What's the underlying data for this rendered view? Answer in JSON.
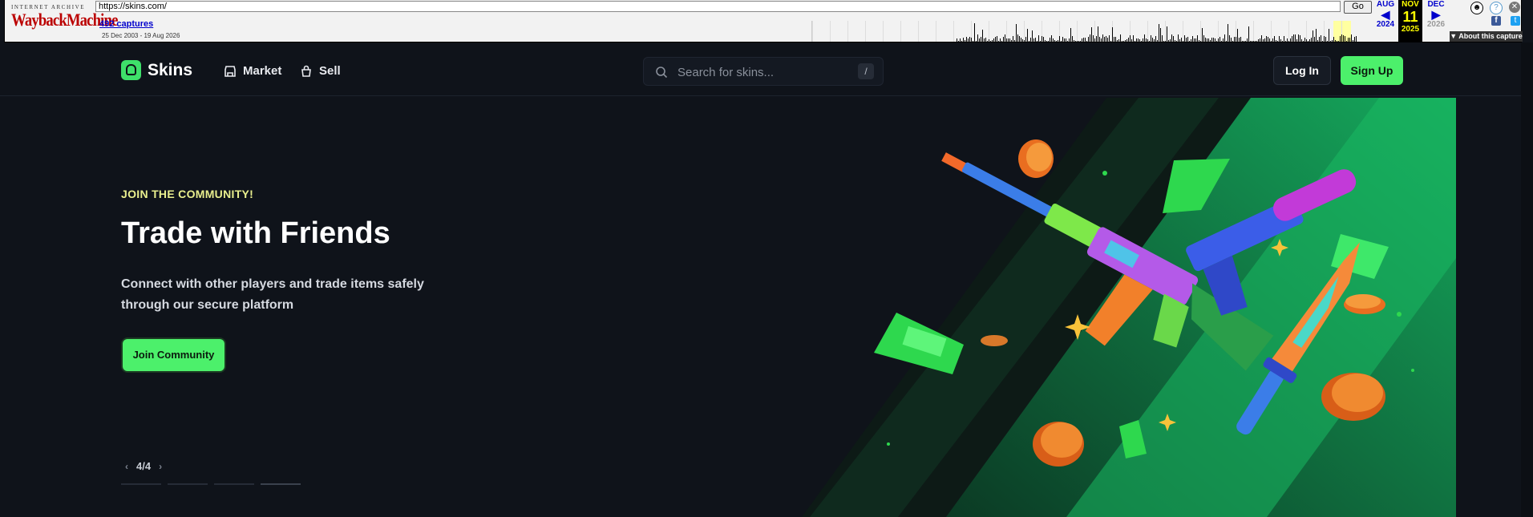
{
  "wayback": {
    "logo_top": "INTERNET ARCHIVE",
    "logo_main": "WaybackMachine",
    "url": "https://skins.com/",
    "go_label": "Go",
    "captures": "492 captures",
    "date_range": "25 Dec 2003 - 19 Aug 2026",
    "prev_month": "AUG",
    "cur_month": "NOV",
    "next_month": "DEC",
    "cur_day": "11",
    "prev_year": "2024",
    "cur_year": "2025",
    "next_year": "2026",
    "about": "About this capture"
  },
  "nav": {
    "brand": "Skins",
    "market": "Market",
    "sell": "Sell",
    "search_placeholder": "Search for skins...",
    "search_shortcut": "/",
    "login": "Log In",
    "signup": "Sign Up"
  },
  "hero": {
    "eyebrow": "JOIN THE COMMUNITY!",
    "title": "Trade with Friends",
    "subtitle": "Connect with other players and trade items safely through our secure platform",
    "cta": "Join Community",
    "pager": "4/4"
  },
  "colors": {
    "accent": "#4cf06b",
    "background": "#0f131a",
    "eyebrow": "#e9ef8e"
  }
}
